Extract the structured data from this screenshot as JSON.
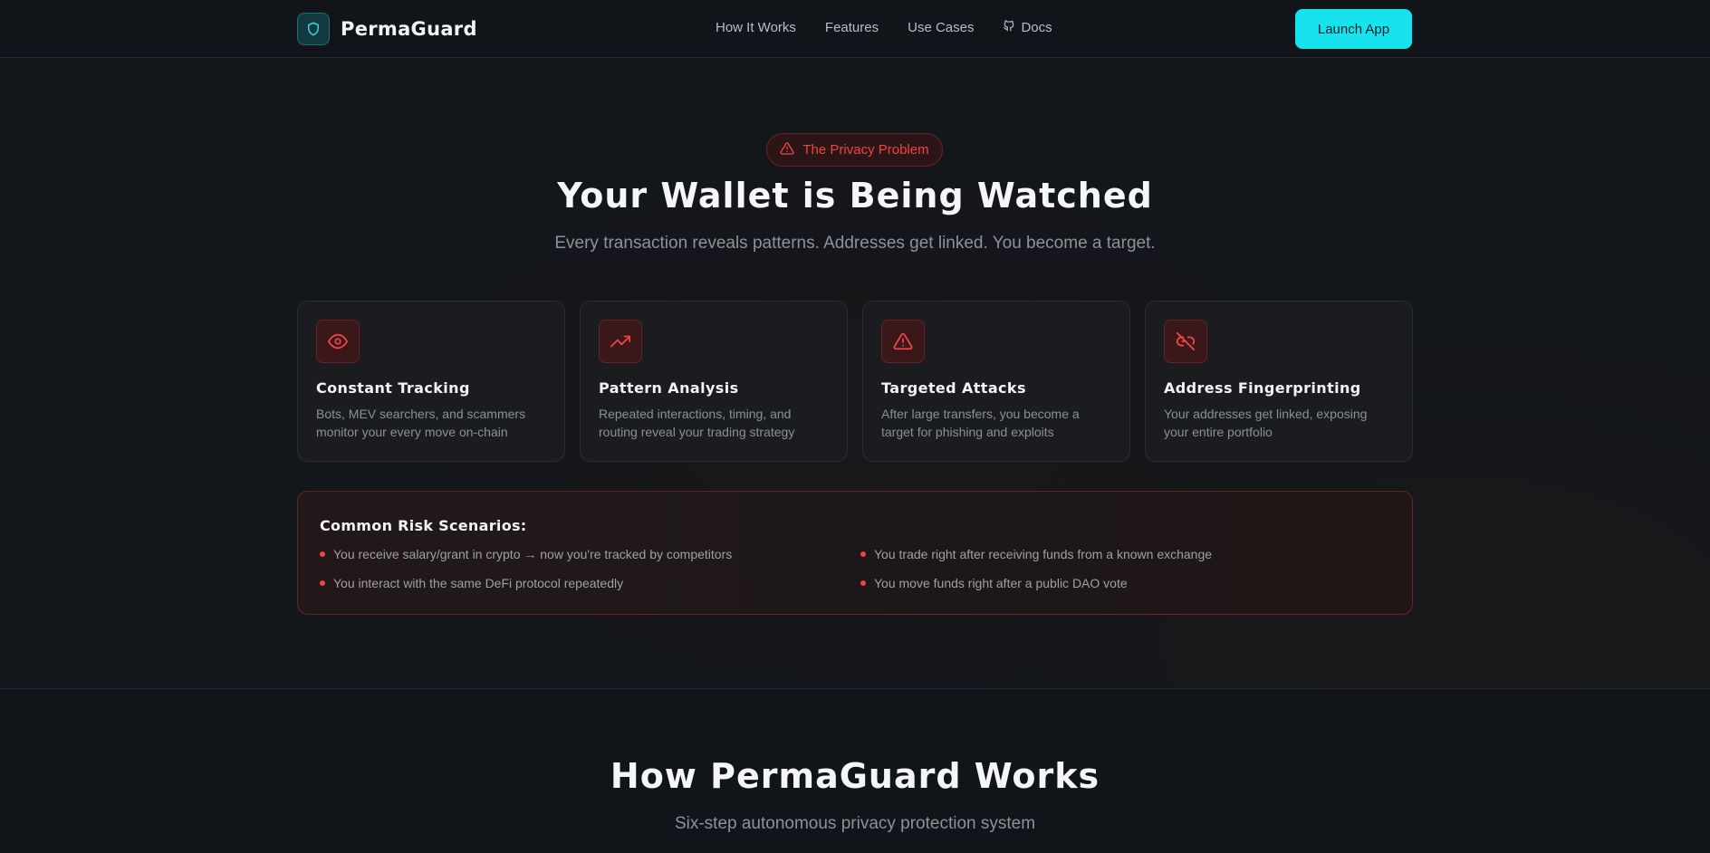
{
  "nav": {
    "brand": "PermaGuard",
    "links": [
      {
        "label": "How It Works"
      },
      {
        "label": "Features"
      },
      {
        "label": "Use Cases"
      },
      {
        "label": "Docs",
        "icon": "github-icon"
      }
    ],
    "cta": "Launch App"
  },
  "hero": {
    "badge": "The Privacy Problem",
    "badge_icon": "warning-icon",
    "title": "Your Wallet is Being Watched",
    "subtitle": "Every transaction reveals patterns. Addresses get linked. You become a target."
  },
  "cards": [
    {
      "icon": "eye-icon",
      "title": "Constant Tracking",
      "desc_line1": "Bots, MEV searchers, and scammers",
      "desc_line2": "monitor your every move on-chain"
    },
    {
      "icon": "trending-up-icon",
      "title": "Pattern Analysis",
      "desc_line1": "Repeated interactions, timing, and",
      "desc_line2": "routing reveal your trading strategy"
    },
    {
      "icon": "warning-icon",
      "title": "Targeted Attacks",
      "desc_line1": "After large transfers, you become a",
      "desc_line2": "target for phishing and exploits"
    },
    {
      "icon": "unlink-icon",
      "title": "Address Fingerprinting",
      "desc_line1": "Your addresses get linked, exposing",
      "desc_line2": "your entire portfolio"
    }
  ],
  "risks": {
    "title": "Common Risk Scenarios:",
    "items": [
      "You receive salary/grant in crypto → now you're tracked by competitors",
      "You trade right after receiving funds from a known exchange",
      "You interact with the same DeFi protocol repeatedly",
      "You move funds right after a public DAO vote"
    ]
  },
  "how_it_works": {
    "title": "How PermaGuard Works",
    "subtitle": "Six-step autonomous privacy protection system"
  },
  "colors": {
    "accent": "#17e3ef",
    "danger": "#ef4444",
    "background": "#13161b"
  }
}
